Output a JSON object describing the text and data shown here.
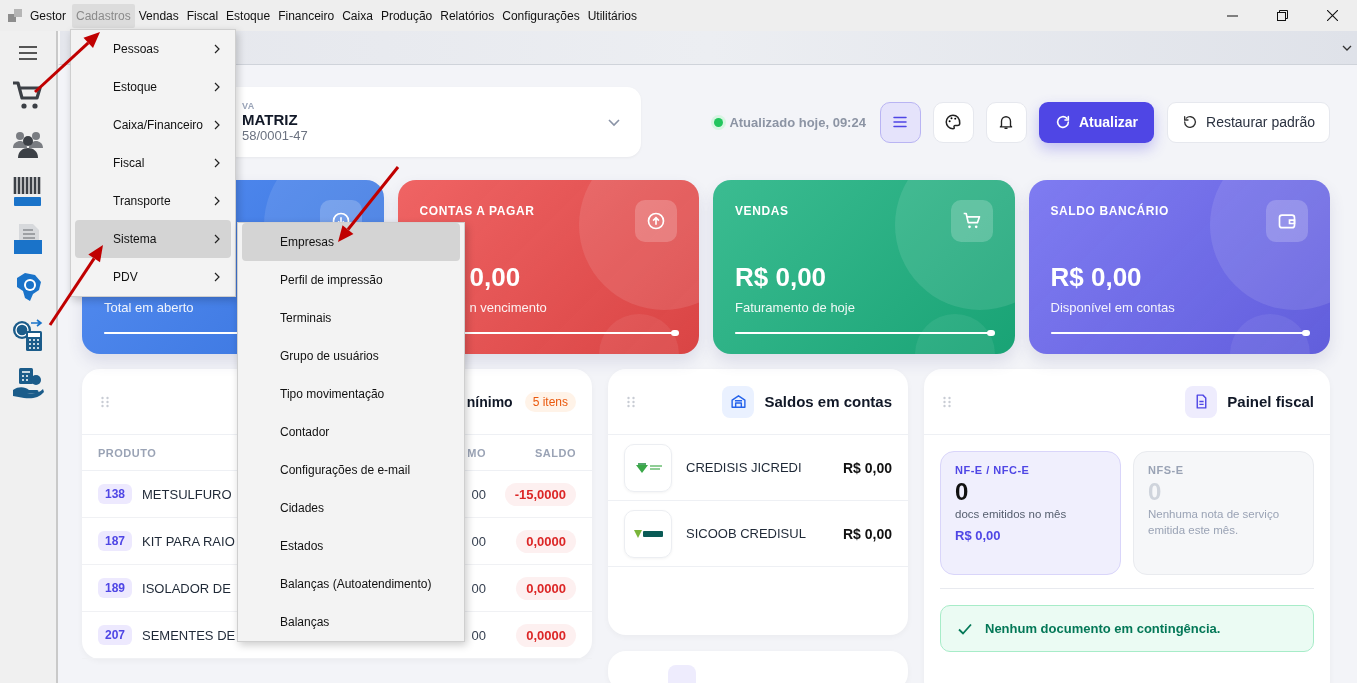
{
  "menubar": {
    "app": "Gestor",
    "menus": [
      {
        "label": "Cadastros",
        "selected": true
      },
      {
        "label": "Vendas",
        "selected": false
      },
      {
        "label": "Fiscal",
        "selected": false
      },
      {
        "label": "Estoque",
        "selected": false
      },
      {
        "label": "Financeiro",
        "selected": false
      },
      {
        "label": "Caixa",
        "selected": false
      },
      {
        "label": "Produção",
        "selected": false
      },
      {
        "label": "Relatórios",
        "selected": false
      },
      {
        "label": "Configurações",
        "selected": false
      },
      {
        "label": "Utilitários",
        "selected": false
      }
    ]
  },
  "dropdown": {
    "items": [
      {
        "label": "Pessoas",
        "selected": false
      },
      {
        "label": "Estoque",
        "selected": false
      },
      {
        "label": "Caixa/Financeiro",
        "selected": false
      },
      {
        "label": "Fiscal",
        "selected": false
      },
      {
        "label": "Transporte",
        "selected": false
      },
      {
        "label": "Sistema",
        "selected": true
      },
      {
        "label": "PDV",
        "selected": false
      }
    ]
  },
  "submenu": {
    "items": [
      {
        "label": "Empresas",
        "selected": true
      },
      {
        "label": "Perfil de impressão",
        "selected": false
      },
      {
        "label": "Terminais",
        "selected": false
      },
      {
        "label": "Grupo de usuários",
        "selected": false
      },
      {
        "label": "Tipo movimentação",
        "selected": false
      },
      {
        "label": "Contador",
        "selected": false
      },
      {
        "label": "Configurações de e-mail",
        "selected": false
      },
      {
        "label": "Cidades",
        "selected": false
      },
      {
        "label": "Estados",
        "selected": false
      },
      {
        "label": "Balanças (Autoatendimento)",
        "selected": false
      },
      {
        "label": "Balanças",
        "selected": false
      }
    ]
  },
  "company": {
    "label": "VA",
    "name": "MATRIZ",
    "cnpj": "58/0001-47"
  },
  "status": {
    "text": "Atualizado hoje, 09:24"
  },
  "toolbar": {
    "icon_buttons": [
      {
        "kind": "menu",
        "selected": true
      },
      {
        "kind": "palette",
        "selected": false
      },
      {
        "kind": "bell",
        "selected": false
      }
    ],
    "refresh_button": "Atualizar",
    "reset_button": "Restaurar padrão"
  },
  "stat_cards": [
    {
      "color": "#3b7cf0",
      "subtitle": "Total em aberto",
      "level": 1
    },
    {
      "color": "#ec4a4a",
      "title": "CONTAS A PAGAR",
      "value": "0,00",
      "subtitle": "n vencimento",
      "level": 1
    },
    {
      "color": "#1bb17f",
      "title": "VENDAS",
      "value": "R$ 0,00",
      "subtitle": "Faturamento de hoje",
      "level": 1
    },
    {
      "color": "#6a66ef",
      "title": "SALDO BANCÁRIO",
      "value": "R$ 0,00",
      "subtitle": "Disponível em contas",
      "level": 1
    }
  ],
  "stock_panel": {
    "title": "nínimo",
    "badge": "5 itens",
    "columns": [
      "PRODUTO",
      "MO",
      "SALDO"
    ],
    "rows": [
      {
        "code": "138",
        "name": "METSULFURO",
        "minimum": "00",
        "balance": "-15,0000"
      },
      {
        "code": "187",
        "name": "KIT PARA RAIO",
        "minimum": "00",
        "balance": "0,0000"
      },
      {
        "code": "189",
        "name": "ISOLADOR DE",
        "minimum": "00",
        "balance": "0,0000"
      },
      {
        "code": "207",
        "name": "SEMENTES DE",
        "minimum": "00",
        "balance": "0,0000"
      }
    ]
  },
  "accounts_panel": {
    "title": "Saldos em contas",
    "rows": [
      {
        "name": "CREDISIS JICREDI",
        "amount": "R$ 0,00"
      },
      {
        "name": "SICOOB CREDISUL",
        "amount": "R$ 0,00"
      }
    ]
  },
  "fiscal_panel": {
    "title": "Painel fiscal",
    "tiles": [
      {
        "label": "NF-E / NFC-E",
        "count": "0",
        "caption": "docs emitidos no mês",
        "amount": "R$ 0,00",
        "disabled": false
      },
      {
        "label": "NFS-E",
        "count": "0",
        "caption": "Nenhuma nota de serviço emitida este mês.",
        "disabled": true
      }
    ],
    "notice": "Nenhum documento em contingência."
  }
}
